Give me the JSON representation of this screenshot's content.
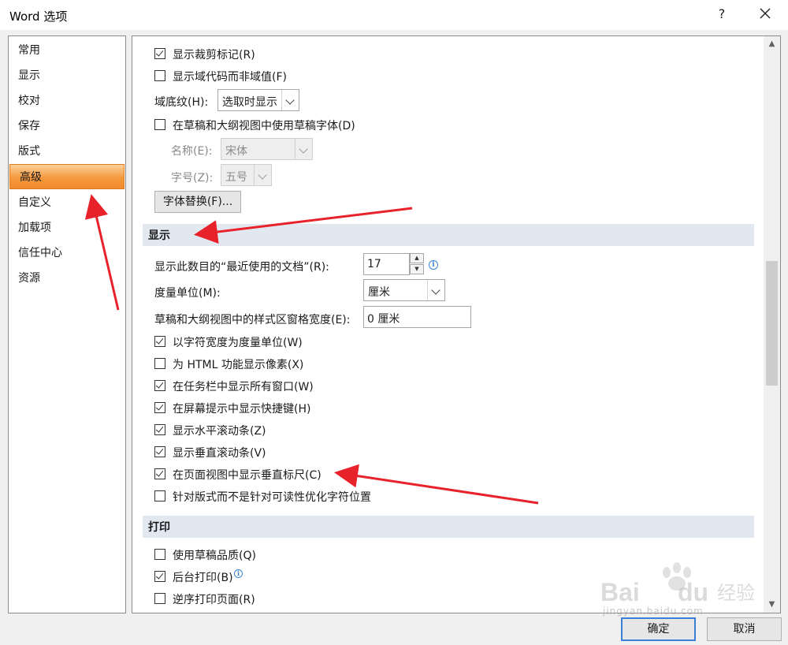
{
  "window": {
    "title": "Word 选项",
    "help": "?"
  },
  "nav": {
    "items": [
      "常用",
      "显示",
      "校对",
      "保存",
      "版式",
      "高级",
      "自定义",
      "加载项",
      "信任中心",
      "资源"
    ],
    "selected_index": 5
  },
  "top_options": {
    "crop_marks": {
      "label": "显示裁剪标记(R)",
      "checked": true
    },
    "field_codes": {
      "label": "显示域代码而非域值(F)",
      "checked": false
    },
    "field_shading": {
      "label": "域底纹(H):",
      "value": "选取时显示"
    },
    "draft_font": {
      "label": "在草稿和大纲视图中使用草稿字体(D)",
      "checked": false
    },
    "font_name": {
      "label": "名称(E):",
      "value": "宋体"
    },
    "font_size": {
      "label": "字号(Z):",
      "value": "五号"
    },
    "font_substitution_button": "字体替换(F)..."
  },
  "display_section": {
    "header": "显示",
    "recent_docs": {
      "label": "显示此数目的“最近使用的文档”(R):",
      "value": "17"
    },
    "measure_units": {
      "label": "度量单位(M):",
      "value": "厘米"
    },
    "style_area_width": {
      "label": "草稿和大纲视图中的样式区窗格宽度(E):",
      "value": "0 厘米"
    },
    "checks": [
      {
        "label": "以字符宽度为度量单位(W)",
        "checked": true
      },
      {
        "label": "为 HTML 功能显示像素(X)",
        "checked": false
      },
      {
        "label": "在任务栏中显示所有窗口(W)",
        "checked": true
      },
      {
        "label": "在屏幕提示中显示快捷键(H)",
        "checked": true
      },
      {
        "label": "显示水平滚动条(Z)",
        "checked": true
      },
      {
        "label": "显示垂直滚动条(V)",
        "checked": true
      },
      {
        "label": "在页面视图中显示垂直标尺(C)",
        "checked": true
      },
      {
        "label": "针对版式而不是针对可读性优化字符位置",
        "checked": false
      }
    ]
  },
  "print_section": {
    "header": "打印",
    "checks": [
      {
        "label": "使用草稿品质(Q)",
        "checked": false
      },
      {
        "label": "后台打印(B)",
        "checked": true
      },
      {
        "label": "逆序打印页面(R)",
        "checked": false
      }
    ]
  },
  "footer": {
    "ok": "确定",
    "cancel": "取消"
  },
  "watermark": {
    "brand": "Bai du 经验",
    "url": "jingyan.baidu.com"
  },
  "colors": {
    "selected_nav": "#f59a3e",
    "section_bg": "#e1e8f0",
    "annotation_arrow": "#e8222a"
  }
}
